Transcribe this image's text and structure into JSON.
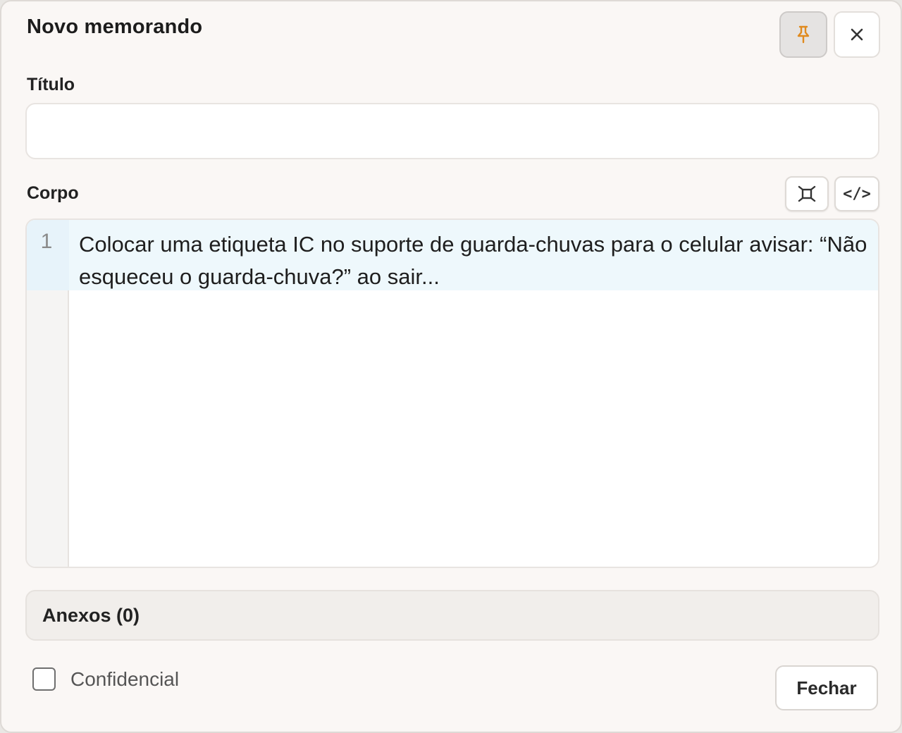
{
  "dialog": {
    "title": "Novo memorando",
    "pin_icon": "pin-icon",
    "close_icon": "close-icon"
  },
  "fields": {
    "title_label": "Título",
    "title_value": "",
    "body_label": "Corpo",
    "expand_icon": "expand-icon",
    "code_toggle_label": "</>"
  },
  "editor": {
    "lines": [
      {
        "number": "1",
        "text": "Colocar uma etiqueta IC no suporte de guarda-chuvas para o celular avisar: “Não esqueceu o guarda-chuva?” ao sair..."
      }
    ]
  },
  "attachments": {
    "label": "Anexos (0)"
  },
  "footer": {
    "confidential_label": "Confidencial",
    "confidential_checked": false,
    "close_button_label": "Fechar"
  },
  "colors": {
    "pin_accent": "#e08a1e",
    "active_line": "#eef8fc"
  }
}
